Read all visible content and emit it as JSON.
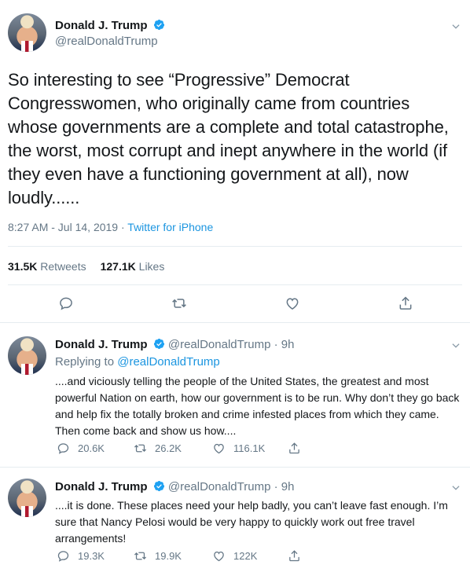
{
  "main_tweet": {
    "name": "Donald J. Trump",
    "handle": "@realDonaldTrump",
    "text": "So interesting to see “Progressive” Democrat Congresswomen, who originally came from countries whose governments are a complete and total catastrophe, the worst, most corrupt and inept anywhere in the world (if they even have a functioning government at all), now loudly......",
    "time": "8:27 AM - Jul 14, 2019",
    "separator": " · ",
    "source": "Twitter for iPhone",
    "retweets_count": "31.5K",
    "retweets_label": "Retweets",
    "likes_count": "127.1K",
    "likes_label": "Likes"
  },
  "replies": [
    {
      "name": "Donald J. Trump",
      "handle": "@realDonaldTrump",
      "age": "· 9h",
      "replying_prefix": "Replying to",
      "replying_to": "@realDonaldTrump",
      "text": "....and viciously telling the people of the United States, the greatest and most powerful Nation on earth, how our government is to be run. Why don’t they go back and help fix the totally broken and crime infested places from which they came. Then come back and show us how....",
      "replies": "20.6K",
      "retweets": "26.2K",
      "likes": "116.1K"
    },
    {
      "name": "Donald J. Trump",
      "handle": "@realDonaldTrump",
      "age": "· 9h",
      "text": "....it is done. These places need your help badly, you can’t leave fast enough. I’m sure that Nancy Pelosi would be very happy to quickly work out free travel arrangements!",
      "replies": "19.3K",
      "retweets": "19.9K",
      "likes": "122K"
    }
  ],
  "icons": [
    "reply-icon",
    "retweet-icon",
    "like-icon",
    "share-icon",
    "verified-badge-icon",
    "chevron-down-icon"
  ],
  "colors": {
    "link": "#1b95e0",
    "muted": "#657786",
    "text": "#14171a",
    "divider": "#e6ecf0"
  }
}
